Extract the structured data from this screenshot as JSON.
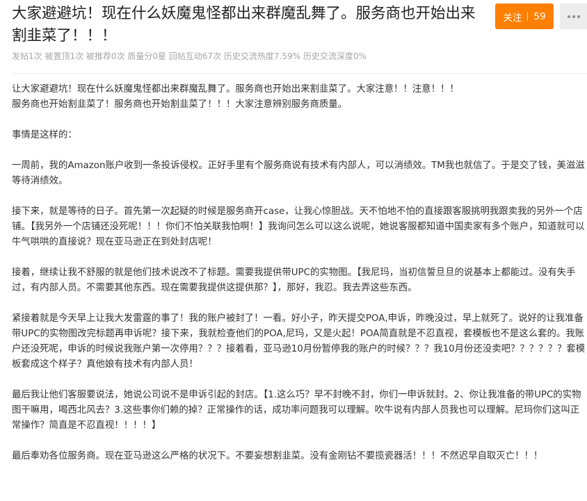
{
  "post": {
    "title": "大家避避坑！现在什么妖魔鬼怪都出来群魔乱舞了。服务商也开始出来割韭菜了！！！",
    "stats": "发帖1次 被置顶1次 被推荐0次 质量分0星 回帖互动67次 历史交流热度7.59% 历史交流深度0%"
  },
  "actions": {
    "follow_label": "关注",
    "follow_count": "59"
  },
  "content": {
    "paragraphs": [
      "让大家避避坑！现在什么妖魔鬼怪都出来群魔乱舞了。服务商也开始出来割韭菜了。大家注意！！注意！！！\n服务商也开始割韭菜了！服务商也开始割韭菜了！！！大家注意辨别服务商质量。",
      "事情是这样的：",
      "一周前，我的Amazon账户收到一条投诉侵权。正好手里有个服务商说有技术有内部人，可以消绩效。TM我也就信了。于是交了钱，美滋滋等待消绩效。",
      "接下来，就是等待的日子。首先第一次起疑的时候是服务商开case，让我心惊胆战。天不怕地不怕的直接跟客服挑明我跟卖我的另外一个店铺。【我另外一个店铺还没死呢！！！你们不怕关联我怕啊！】我询问怎么可以这么说呢，她说客服都知道中国卖家有多个账户，知道就可以牛气哄哄的直接说？现在亚马逊正在到处封店呢！",
      "接着，继续让我不舒服的就是他们技术说改不了标题。需要我提供带UPC的实物图。【我尼玛，当初信誓旦旦的说基本上都能过。没有失手过，有内部人员。不需要其他东西。现在需要我提供这提供那？】，那好，我忍。我去弄这些东西。",
      "紧接着就是今天早上让我大发雷霆的事了！我的账户被封了！一看。好小子，昨天提交POA,申诉，昨晚没过，早上就死了。说好的让我准备带UPC的实物图改完标题再申诉呢？接下来，我就检查他们的POA,尼玛，又是火起！POA简直就是不忍直视，套模板也不是这么套的。我账户还没死呢，申诉的时候说我账户第一次停用？？？接着看，亚马逊10月份暂停我的账户的时候？？？我10月份还没卖吧？？？？？？套模板套成这个样子？真他娘有技术有内部人员！",
      "最后我让他们客服要说法，她说公司说不是申诉引起的封店。【1.这么巧？早不封晚不封，你们一申诉就封。2、你让我准备的带UPC的实物图干嘛用，喝西北风去？3.这些事你们赖的掉？正常操作的话，成功率问题我可以理解。吹牛说有内部人员我也可以理解。尼玛你们这叫正常操作？简直是不忍直视！！！！】",
      "最后奉劝各位服务商。现在亚马逊这么严格的状况下。不要妄想割韭菜。没有金刚钻不要揽瓷器活！！！不然迟早自取灭亡！！！"
    ]
  }
}
